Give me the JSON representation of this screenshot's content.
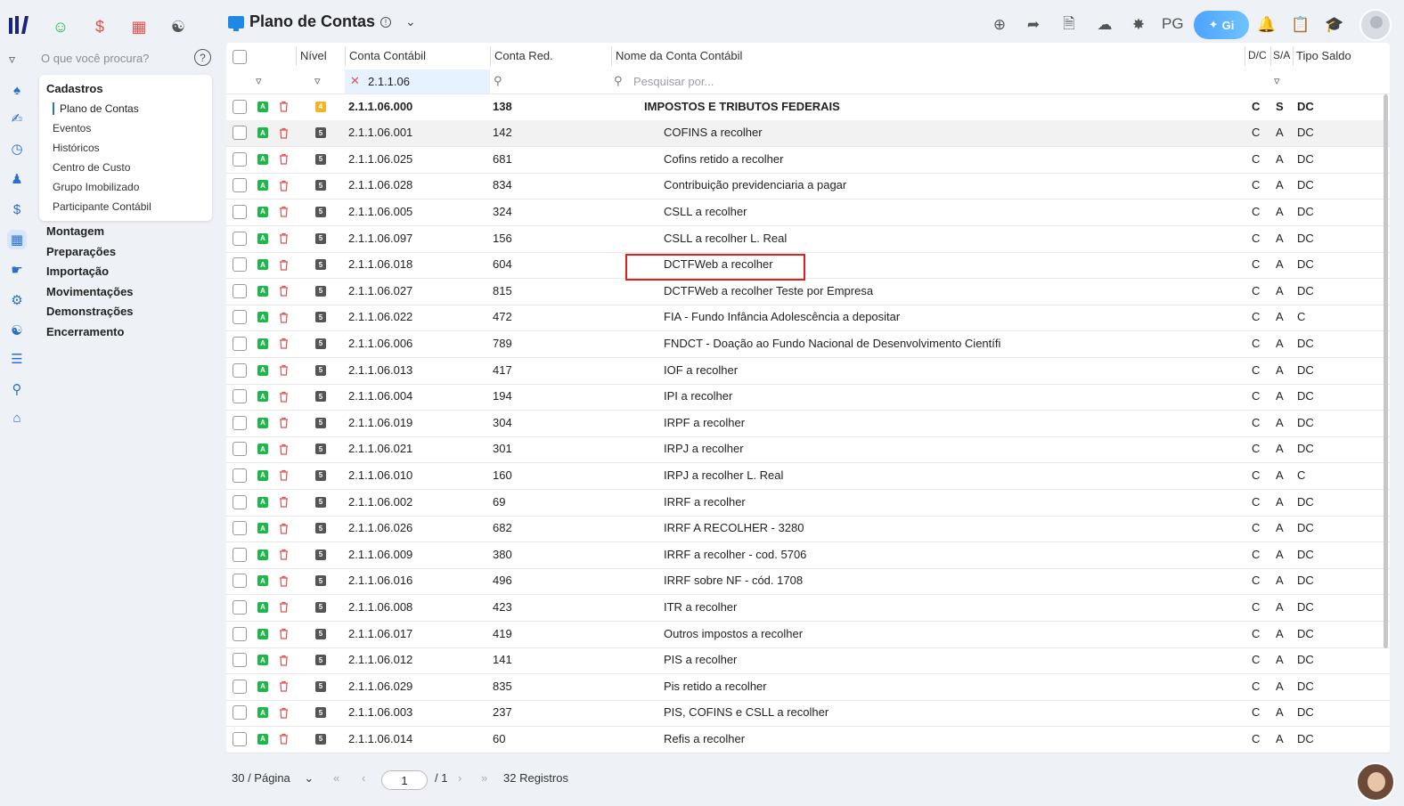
{
  "app": {
    "title": "Plano de Contas",
    "info_icon": "info-icon",
    "pg_label": "PG",
    "gi_label": "Gi"
  },
  "top_modules": [
    "people-icon",
    "dollar-icon",
    "grid-icon",
    "money-bag-icon"
  ],
  "top_actions": [
    "plus-circle-icon",
    "forward-icon",
    "document-icon",
    "cloud-upload-icon",
    "satellite-icon",
    "bell-icon",
    "receipt-icon",
    "graduation-cap-icon"
  ],
  "search": {
    "placeholder": "O que você procura?"
  },
  "nav": {
    "group": "Cadastros",
    "items": [
      "Plano de Contas",
      "Eventos",
      "Históricos",
      "Centro de Custo",
      "Grupo Imobilizado",
      "Participante Contábil"
    ],
    "active": "Plano de Contas",
    "sections": [
      "Montagem",
      "Preparações",
      "Importação",
      "Movimentações",
      "Demonstrações",
      "Encerramento"
    ]
  },
  "table": {
    "headers": {
      "nivel": "Nível",
      "conta": "Conta Contábil",
      "red": "Conta Red.",
      "nome": "Nome da Conta Contábil",
      "dc": "D/C",
      "sa": "S/A",
      "tipo": "Tipo Saldo"
    },
    "filter_value": "2.1.1.06",
    "name_placeholder": "Pesquisar por...",
    "rows": [
      {
        "level": "4",
        "conta": "2.1.1.06.000",
        "red": "138",
        "nome": "IMPOSTOS E TRIBUTOS FEDERAIS",
        "dc": "C",
        "sa": "S",
        "tipo": "DC",
        "bold": true
      },
      {
        "level": "5",
        "conta": "2.1.1.06.001",
        "red": "142",
        "nome": "COFINS a recolher",
        "dc": "C",
        "sa": "A",
        "tipo": "DC"
      },
      {
        "level": "5",
        "conta": "2.1.1.06.025",
        "red": "681",
        "nome": "Cofins retido a recolher",
        "dc": "C",
        "sa": "A",
        "tipo": "DC"
      },
      {
        "level": "5",
        "conta": "2.1.1.06.028",
        "red": "834",
        "nome": "Contribuição previdenciaria a pagar",
        "dc": "C",
        "sa": "A",
        "tipo": "DC"
      },
      {
        "level": "5",
        "conta": "2.1.1.06.005",
        "red": "324",
        "nome": "CSLL a recolher",
        "dc": "C",
        "sa": "A",
        "tipo": "DC"
      },
      {
        "level": "5",
        "conta": "2.1.1.06.097",
        "red": "156",
        "nome": "CSLL a recolher L. Real",
        "dc": "C",
        "sa": "A",
        "tipo": "DC"
      },
      {
        "level": "5",
        "conta": "2.1.1.06.018",
        "red": "604",
        "nome": "DCTFWeb a recolher",
        "dc": "C",
        "sa": "A",
        "tipo": "DC"
      },
      {
        "level": "5",
        "conta": "2.1.1.06.027",
        "red": "815",
        "nome": "DCTFWeb a recolher Teste por Empresa",
        "dc": "C",
        "sa": "A",
        "tipo": "DC"
      },
      {
        "level": "5",
        "conta": "2.1.1.06.022",
        "red": "472",
        "nome": "FIA - Fundo Infância Adolescência a depositar",
        "dc": "C",
        "sa": "A",
        "tipo": "C"
      },
      {
        "level": "5",
        "conta": "2.1.1.06.006",
        "red": "789",
        "nome": "FNDCT - Doação ao Fundo Nacional de Desenvolvimento Científi",
        "dc": "C",
        "sa": "A",
        "tipo": "DC"
      },
      {
        "level": "5",
        "conta": "2.1.1.06.013",
        "red": "417",
        "nome": "IOF a recolher",
        "dc": "C",
        "sa": "A",
        "tipo": "DC"
      },
      {
        "level": "5",
        "conta": "2.1.1.06.004",
        "red": "194",
        "nome": "IPI a recolher",
        "dc": "C",
        "sa": "A",
        "tipo": "DC"
      },
      {
        "level": "5",
        "conta": "2.1.1.06.019",
        "red": "304",
        "nome": "IRPF a recolher",
        "dc": "C",
        "sa": "A",
        "tipo": "DC"
      },
      {
        "level": "5",
        "conta": "2.1.1.06.021",
        "red": "301",
        "nome": "IRPJ a recolher",
        "dc": "C",
        "sa": "A",
        "tipo": "DC"
      },
      {
        "level": "5",
        "conta": "2.1.1.06.010",
        "red": "160",
        "nome": "IRPJ a recolher L. Real",
        "dc": "C",
        "sa": "A",
        "tipo": "C"
      },
      {
        "level": "5",
        "conta": "2.1.1.06.002",
        "red": "69",
        "nome": "IRRF a recolher",
        "dc": "C",
        "sa": "A",
        "tipo": "DC"
      },
      {
        "level": "5",
        "conta": "2.1.1.06.026",
        "red": "682",
        "nome": "IRRF A RECOLHER - 3280",
        "dc": "C",
        "sa": "A",
        "tipo": "DC"
      },
      {
        "level": "5",
        "conta": "2.1.1.06.009",
        "red": "380",
        "nome": "IRRF a recolher - cod. 5706",
        "dc": "C",
        "sa": "A",
        "tipo": "DC"
      },
      {
        "level": "5",
        "conta": "2.1.1.06.016",
        "red": "496",
        "nome": "IRRF sobre NF - cód. 1708",
        "dc": "C",
        "sa": "A",
        "tipo": "DC"
      },
      {
        "level": "5",
        "conta": "2.1.1.06.008",
        "red": "423",
        "nome": "ITR a recolher",
        "dc": "C",
        "sa": "A",
        "tipo": "DC"
      },
      {
        "level": "5",
        "conta": "2.1.1.06.017",
        "red": "419",
        "nome": "Outros impostos a recolher",
        "dc": "C",
        "sa": "A",
        "tipo": "DC"
      },
      {
        "level": "5",
        "conta": "2.1.1.06.012",
        "red": "141",
        "nome": "PIS a recolher",
        "dc": "C",
        "sa": "A",
        "tipo": "DC"
      },
      {
        "level": "5",
        "conta": "2.1.1.06.029",
        "red": "835",
        "nome": "Pis retido a recolher",
        "dc": "C",
        "sa": "A",
        "tipo": "DC"
      },
      {
        "level": "5",
        "conta": "2.1.1.06.003",
        "red": "237",
        "nome": "PIS, COFINS e CSLL a recolher",
        "dc": "C",
        "sa": "A",
        "tipo": "DC"
      },
      {
        "level": "5",
        "conta": "2.1.1.06.014",
        "red": "60",
        "nome": "Refis a recolher",
        "dc": "C",
        "sa": "A",
        "tipo": "DC"
      }
    ],
    "colors": {
      "badge_a": "#1eb84a",
      "level4": "#f0b429",
      "level5": "#555555",
      "trash": "#e05252",
      "highlight": "#e11d1d"
    }
  },
  "footer": {
    "per_page": "30 / Página",
    "page": "1",
    "total_pages": "/ 1",
    "records": "32 Registros"
  }
}
